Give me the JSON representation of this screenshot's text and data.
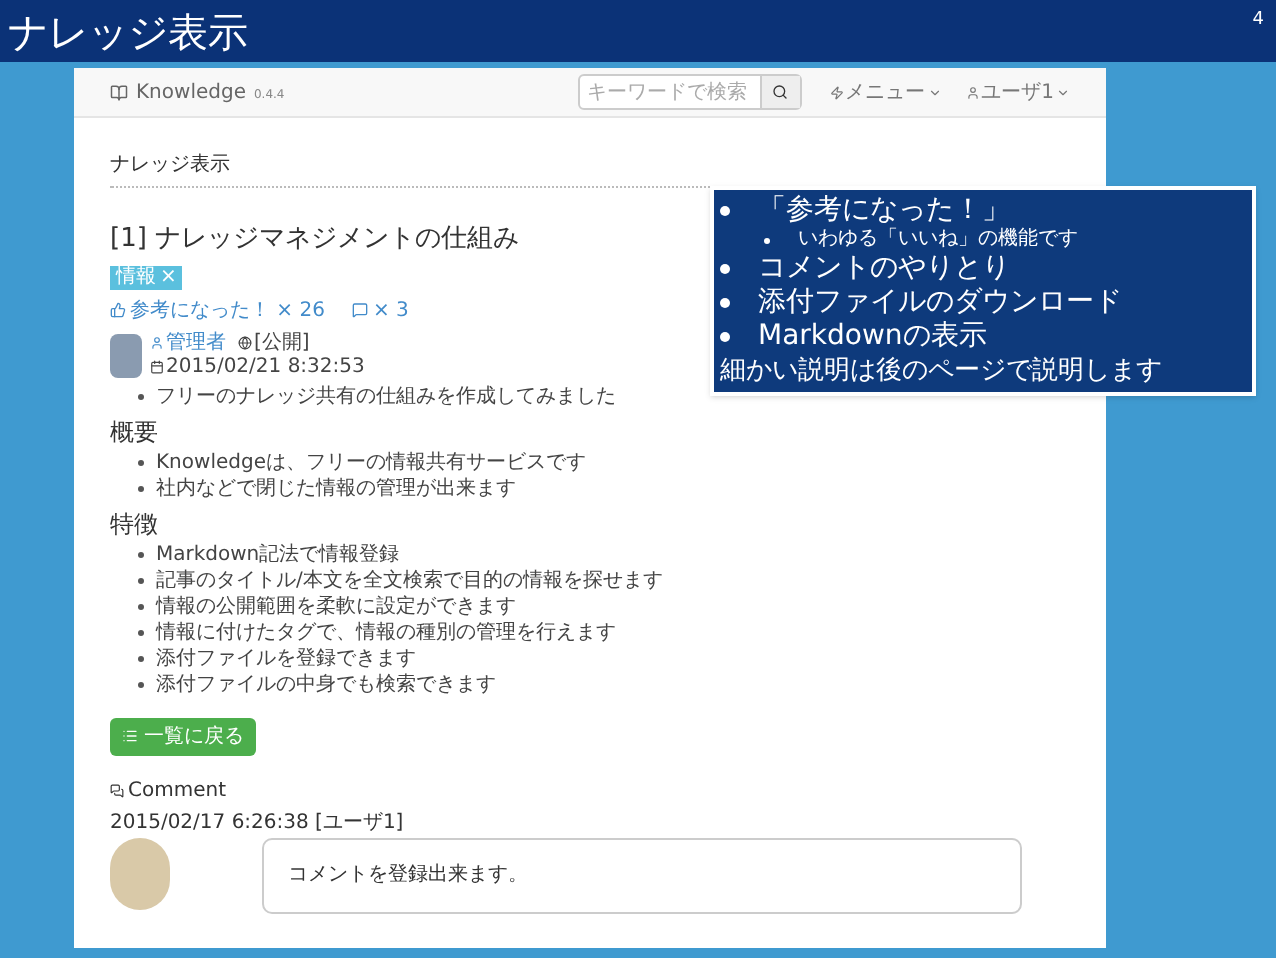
{
  "slide": {
    "title": "ナレッジ表示",
    "page_number": "4"
  },
  "navbar": {
    "brand": "Knowledge",
    "version": "0.4.4",
    "search": {
      "placeholder": "キーワードで検索"
    },
    "menu": "メニュー",
    "user": "ユーザ1"
  },
  "page_heading": "ナレッジ表示",
  "article": {
    "title": "[1] ナレッジマネジメントの仕組み",
    "tags": [
      {
        "label": "情報",
        "remove": "×"
      }
    ],
    "like": "参考になった！ × 26",
    "comment_count": "× 3",
    "author": "管理者",
    "visibility": "[公開]",
    "date": "2015/02/21 8:32:53",
    "body": [
      {
        "kind": "bullets",
        "items": [
          "フリーのナレッジ共有の仕組みを作成してみました"
        ]
      },
      {
        "kind": "heading",
        "text": "概要"
      },
      {
        "kind": "bullets",
        "items": [
          "Knowledgeは、フリーの情報共有サービスです",
          "社内などで閉じた情報の管理が出来ます"
        ]
      },
      {
        "kind": "heading",
        "text": "特徴"
      },
      {
        "kind": "bullets",
        "items": [
          "Markdown記法で情報登録",
          "記事のタイトル/本文を全文検索で目的の情報を探せます",
          "情報の公開範囲を柔軟に設定ができます",
          "情報に付けたタグで、情報の種別の管理を行えます",
          "添付ファイルを登録できます",
          "添付ファイルの中身でも検索できます"
        ]
      }
    ]
  },
  "back_button": "一覧に戻る",
  "comments_section": {
    "heading": "Comment",
    "items": [
      {
        "meta": "2015/02/17 6:26:38 [ユーザ1]",
        "text": "コメントを登録出来ます。"
      }
    ]
  },
  "callout": {
    "items": [
      {
        "text": "「参考になった！」",
        "children": [
          {
            "text": "いわゆる「いいね」の機能です"
          }
        ]
      },
      {
        "text": "コメントのやりとり"
      },
      {
        "text": "添付ファイルのダウンロード"
      },
      {
        "text": "Markdownの表示"
      }
    ],
    "note": "細かい説明は後のページで説明します"
  }
}
